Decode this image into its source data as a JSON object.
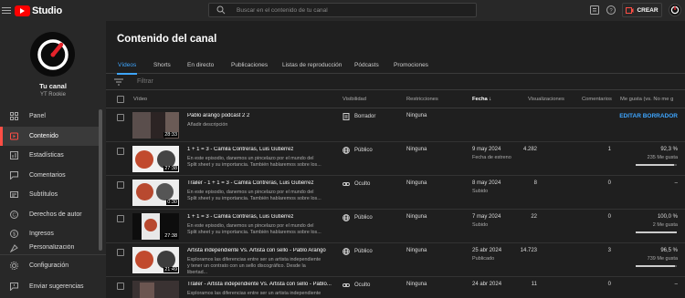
{
  "app": {
    "name": "Studio"
  },
  "search": {
    "placeholder": "Buscar en el contenido de tu canal"
  },
  "header": {
    "create_label": "CREAR"
  },
  "channel": {
    "label": "Tu canal",
    "name": "YT Rookie"
  },
  "sidebar": {
    "items": [
      {
        "label": "Panel",
        "icon": "dashboard-icon"
      },
      {
        "label": "Contenido",
        "icon": "content-icon",
        "active": true
      },
      {
        "label": "Estadísticas",
        "icon": "analytics-icon"
      },
      {
        "label": "Comentarios",
        "icon": "comments-icon"
      },
      {
        "label": "Subtítulos",
        "icon": "subtitles-icon"
      },
      {
        "label": "Derechos de autor",
        "icon": "copyright-icon"
      },
      {
        "label": "Ingresos",
        "icon": "earn-icon"
      },
      {
        "label": "Personalización",
        "icon": "customization-icon"
      }
    ],
    "bottom": [
      {
        "label": "Configuración",
        "icon": "settings-icon"
      },
      {
        "label": "Enviar sugerencias",
        "icon": "feedback-icon"
      }
    ]
  },
  "main": {
    "title": "Contenido del canal",
    "tabs": [
      "Vídeos",
      "Shorts",
      "En directo",
      "Publicaciones",
      "Listas de reproducción",
      "Pódcasts",
      "Promociones"
    ],
    "filter_placeholder": "Filtrar"
  },
  "table": {
    "headers": {
      "video": "Vídeo",
      "visibility": "Visibilidad",
      "restrictions": "Restricciones",
      "date": "Fecha",
      "views": "Visualizaciones",
      "comments": "Comentarios",
      "likes": "Me gusta (vs. No me g"
    },
    "rows": [
      {
        "title": "Pablo arango podcast 2 2",
        "desc": "Añadir descripción",
        "duration": "28:33",
        "visibility": "Borrador",
        "visibility_icon": "draft-icon",
        "restrictions": "Ninguna",
        "date": "",
        "date_sub": "",
        "views": "",
        "comments": "",
        "likes": "",
        "likes_sub": "",
        "action": "EDITAR BORRADOR"
      },
      {
        "title": "1 + 1 = 3 - Camila Contreras, Luis Gutiérrez",
        "desc": "En este episodio, danemos un pincelazo por el mundo del Split sheet y su importancia. También hablaremos sobre los...",
        "duration": "27:38",
        "visibility": "Público",
        "visibility_icon": "globe-icon",
        "restrictions": "Ninguna",
        "date": "9 may 2024",
        "date_sub": "Fecha de estreno",
        "views": "4.282",
        "comments": "1",
        "likes": "92,3 %",
        "likes_sub": "235 Me gusta",
        "like_ratio": 0.923
      },
      {
        "title": "Tráiler - 1 + 1 = 3 - Camila Contreras, Luis Gutiérrez",
        "desc": "En este episodio, danemos un pincelazo por el mundo del Split sheet y su importancia. También hablaremos sobre los...",
        "duration": "0:30",
        "visibility": "Oculto",
        "visibility_icon": "link-icon",
        "restrictions": "Ninguna",
        "date": "8 may 2024",
        "date_sub": "Subido",
        "views": "8",
        "comments": "0",
        "likes": "–",
        "likes_sub": ""
      },
      {
        "title": "1 + 1 = 3 - Camila Contreras, Luis Gutiérrez",
        "desc": "En este episodio, danemos un pincelazo por el mundo del Split sheet y su importancia. También hablaremos sobre los...",
        "duration": "27:38",
        "visibility": "Público",
        "visibility_icon": "globe-icon",
        "restrictions": "Ninguna",
        "date": "7 may 2024",
        "date_sub": "Subido",
        "views": "22",
        "comments": "0",
        "likes": "100,0 %",
        "likes_sub": "2 Me gusta",
        "like_ratio": 1.0
      },
      {
        "title": "Artista independiente Vs. Artista con sello - Pablo Arango",
        "desc": "Exploramos las diferencias entre ser un artista independiente y tener un contrato con un sello discográfico. Desde la libertad...",
        "duration": "21:49",
        "visibility": "Público",
        "visibility_icon": "globe-icon",
        "restrictions": "Ninguna",
        "date": "25 abr 2024",
        "date_sub": "Publicado",
        "views": "14.723",
        "comments": "3",
        "likes": "96,5 %",
        "likes_sub": "739 Me gusta",
        "like_ratio": 0.965
      },
      {
        "title": "Tráiler - Artista independiente Vs. Artista con sello - Pablo...",
        "desc": "Exploramos las diferencias entre ser un artista independiente y",
        "duration": "",
        "visibility": "Oculto",
        "visibility_icon": "link-icon",
        "restrictions": "Ninguna",
        "date": "24 abr 2024",
        "date_sub": "",
        "views": "11",
        "comments": "0",
        "likes": "–",
        "likes_sub": ""
      }
    ]
  }
}
